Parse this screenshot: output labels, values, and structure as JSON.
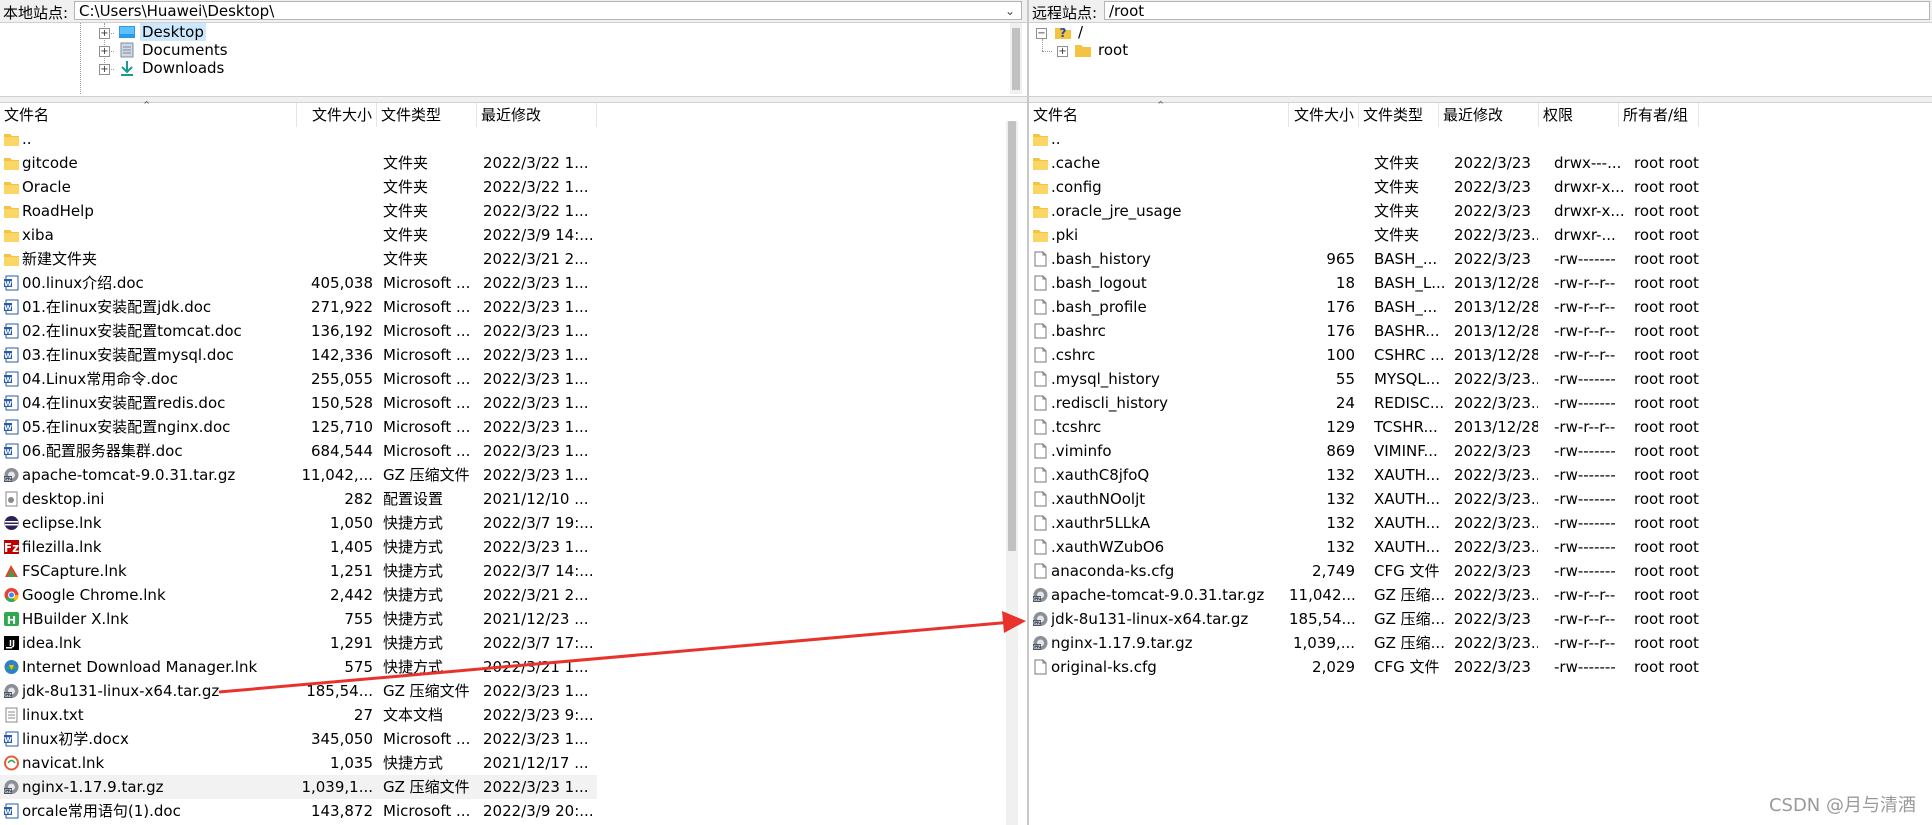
{
  "local": {
    "site_label": "本地站点:",
    "path": "C:\\Users\\Huawei\\Desktop\\",
    "tree": [
      {
        "label": "Desktop",
        "icon": "desktop-folder-icon"
      },
      {
        "label": "Documents",
        "icon": "documents-folder-icon"
      },
      {
        "label": "Downloads",
        "icon": "downloads-folder-icon"
      }
    ],
    "columns": {
      "name": "文件名",
      "size": "文件大小",
      "type": "文件类型",
      "modified": "最近修改"
    },
    "files": [
      {
        "name": "..",
        "size": "",
        "type": "",
        "modified": "",
        "icon": "folder"
      },
      {
        "name": "gitcode",
        "size": "",
        "type": "文件夹",
        "modified": "2022/3/22 1...",
        "icon": "folder"
      },
      {
        "name": "Oracle",
        "size": "",
        "type": "文件夹",
        "modified": "2022/3/22 1...",
        "icon": "folder"
      },
      {
        "name": "RoadHelp",
        "size": "",
        "type": "文件夹",
        "modified": "2022/3/22 1...",
        "icon": "folder"
      },
      {
        "name": "xiba",
        "size": "",
        "type": "文件夹",
        "modified": "2022/3/9 14:...",
        "icon": "folder"
      },
      {
        "name": "新建文件夹",
        "size": "",
        "type": "文件夹",
        "modified": "2022/3/21 2...",
        "icon": "folder"
      },
      {
        "name": "00.linux介绍.doc",
        "size": "405,038",
        "type": "Microsoft ...",
        "modified": "2022/3/23 1...",
        "icon": "word"
      },
      {
        "name": "01.在linux安装配置jdk.doc",
        "size": "271,922",
        "type": "Microsoft ...",
        "modified": "2022/3/23 1...",
        "icon": "word"
      },
      {
        "name": "02.在linux安装配置tomcat.doc",
        "size": "136,192",
        "type": "Microsoft ...",
        "modified": "2022/3/23 1...",
        "icon": "word"
      },
      {
        "name": "03.在linux安装配置mysql.doc",
        "size": "142,336",
        "type": "Microsoft ...",
        "modified": "2022/3/23 1...",
        "icon": "word"
      },
      {
        "name": "04.Linux常用命令.doc",
        "size": "255,055",
        "type": "Microsoft ...",
        "modified": "2022/3/23 1...",
        "icon": "word"
      },
      {
        "name": "04.在linux安装配置redis.doc",
        "size": "150,528",
        "type": "Microsoft ...",
        "modified": "2022/3/23 1...",
        "icon": "word"
      },
      {
        "name": "05.在linux安装配置nginx.doc",
        "size": "125,710",
        "type": "Microsoft ...",
        "modified": "2022/3/23 1...",
        "icon": "word"
      },
      {
        "name": "06.配置服务器集群.doc",
        "size": "684,544",
        "type": "Microsoft ...",
        "modified": "2022/3/23 1...",
        "icon": "word"
      },
      {
        "name": "apache-tomcat-9.0.31.tar.gz",
        "size": "11,042,...",
        "type": "GZ 压缩文件",
        "modified": "2022/3/23 1...",
        "icon": "archive"
      },
      {
        "name": "desktop.ini",
        "size": "282",
        "type": "配置设置",
        "modified": "2021/12/10 ...",
        "icon": "ini"
      },
      {
        "name": "eclipse.lnk",
        "size": "1,050",
        "type": "快捷方式",
        "modified": "2022/3/7 19:...",
        "icon": "eclipse"
      },
      {
        "name": "filezilla.lnk",
        "size": "1,405",
        "type": "快捷方式",
        "modified": "2022/3/23 1...",
        "icon": "filezilla"
      },
      {
        "name": "FSCapture.lnk",
        "size": "1,251",
        "type": "快捷方式",
        "modified": "2022/3/7 14:...",
        "icon": "fscapture"
      },
      {
        "name": "Google Chrome.lnk",
        "size": "2,442",
        "type": "快捷方式",
        "modified": "2022/3/21 2...",
        "icon": "chrome"
      },
      {
        "name": "HBuilder X.lnk",
        "size": "755",
        "type": "快捷方式",
        "modified": "2021/12/23 ...",
        "icon": "hbuilder"
      },
      {
        "name": "idea.lnk",
        "size": "1,291",
        "type": "快捷方式",
        "modified": "2022/3/7 17:...",
        "icon": "idea"
      },
      {
        "name": "Internet Download Manager.lnk",
        "size": "575",
        "type": "快捷方式",
        "modified": "2022/3/21 1...",
        "icon": "idm"
      },
      {
        "name": "jdk-8u131-linux-x64.tar.gz",
        "size": "185,54...",
        "type": "GZ 压缩文件",
        "modified": "2022/3/23 1...",
        "icon": "archive"
      },
      {
        "name": "linux.txt",
        "size": "27",
        "type": "文本文档",
        "modified": "2022/3/23 9:...",
        "icon": "txt"
      },
      {
        "name": "linux初学.docx",
        "size": "345,050",
        "type": "Microsoft ...",
        "modified": "2022/3/23 1...",
        "icon": "word"
      },
      {
        "name": "navicat.lnk",
        "size": "1,035",
        "type": "快捷方式",
        "modified": "2021/12/17 ...",
        "icon": "navicat"
      },
      {
        "name": "nginx-1.17.9.tar.gz",
        "size": "1,039,1...",
        "type": "GZ 压缩文件",
        "modified": "2022/3/23 1...",
        "icon": "archive",
        "selected": true
      },
      {
        "name": "orcale常用语句(1).doc",
        "size": "143,872",
        "type": "Microsoft ...",
        "modified": "2022/3/9 20:...",
        "icon": "word"
      }
    ]
  },
  "remote": {
    "site_label": "远程站点:",
    "path": "/root",
    "tree": [
      {
        "label": "/",
        "icon": "unknown-folder-icon"
      },
      {
        "label": "root",
        "icon": "folder-icon"
      }
    ],
    "columns": {
      "name": "文件名",
      "size": "文件大小",
      "type": "文件类型",
      "modified": "最近修改",
      "perms": "权限",
      "owner": "所有者/组"
    },
    "files": [
      {
        "name": "..",
        "size": "",
        "type": "",
        "modified": "",
        "perms": "",
        "owner": "",
        "icon": "folder"
      },
      {
        "name": ".cache",
        "size": "",
        "type": "文件夹",
        "modified": "2022/3/23",
        "perms": "drwx---...",
        "owner": "root root",
        "icon": "folder"
      },
      {
        "name": ".config",
        "size": "",
        "type": "文件夹",
        "modified": "2022/3/23",
        "perms": "drwxr-x...",
        "owner": "root root",
        "icon": "folder"
      },
      {
        "name": ".oracle_jre_usage",
        "size": "",
        "type": "文件夹",
        "modified": "2022/3/23",
        "perms": "drwxr-x...",
        "owner": "root root",
        "icon": "folder"
      },
      {
        "name": ".pki",
        "size": "",
        "type": "文件夹",
        "modified": "2022/3/23...",
        "perms": "drwxr-...",
        "owner": "root root",
        "icon": "folder"
      },
      {
        "name": ".bash_history",
        "size": "965",
        "type": "BASH_...",
        "modified": "2022/3/23",
        "perms": "-rw-------",
        "owner": "root root",
        "icon": "blank"
      },
      {
        "name": ".bash_logout",
        "size": "18",
        "type": "BASH_L...",
        "modified": "2013/12/28",
        "perms": "-rw-r--r--",
        "owner": "root root",
        "icon": "blank"
      },
      {
        "name": ".bash_profile",
        "size": "176",
        "type": "BASH_...",
        "modified": "2013/12/28",
        "perms": "-rw-r--r--",
        "owner": "root root",
        "icon": "blank"
      },
      {
        "name": ".bashrc",
        "size": "176",
        "type": "BASHR...",
        "modified": "2013/12/28",
        "perms": "-rw-r--r--",
        "owner": "root root",
        "icon": "blank"
      },
      {
        "name": ".cshrc",
        "size": "100",
        "type": "CSHRC ...",
        "modified": "2013/12/28",
        "perms": "-rw-r--r--",
        "owner": "root root",
        "icon": "blank"
      },
      {
        "name": ".mysql_history",
        "size": "55",
        "type": "MYSQL...",
        "modified": "2022/3/23...",
        "perms": "-rw-------",
        "owner": "root root",
        "icon": "blank"
      },
      {
        "name": ".rediscli_history",
        "size": "24",
        "type": "REDISC...",
        "modified": "2022/3/23...",
        "perms": "-rw-------",
        "owner": "root root",
        "icon": "blank"
      },
      {
        "name": ".tcshrc",
        "size": "129",
        "type": "TCSHR...",
        "modified": "2013/12/28",
        "perms": "-rw-r--r--",
        "owner": "root root",
        "icon": "blank"
      },
      {
        "name": ".viminfo",
        "size": "869",
        "type": "VIMINF...",
        "modified": "2022/3/23",
        "perms": "-rw-------",
        "owner": "root root",
        "icon": "blank"
      },
      {
        "name": ".xauthC8jfoQ",
        "size": "132",
        "type": "XAUTH...",
        "modified": "2022/3/23...",
        "perms": "-rw-------",
        "owner": "root root",
        "icon": "blank"
      },
      {
        "name": ".xauthNOoljt",
        "size": "132",
        "type": "XAUTH...",
        "modified": "2022/3/23...",
        "perms": "-rw-------",
        "owner": "root root",
        "icon": "blank"
      },
      {
        "name": ".xauthr5LLkA",
        "size": "132",
        "type": "XAUTH...",
        "modified": "2022/3/23...",
        "perms": "-rw-------",
        "owner": "root root",
        "icon": "blank"
      },
      {
        "name": ".xauthWZubO6",
        "size": "132",
        "type": "XAUTH...",
        "modified": "2022/3/23...",
        "perms": "-rw-------",
        "owner": "root root",
        "icon": "blank"
      },
      {
        "name": "anaconda-ks.cfg",
        "size": "2,749",
        "type": "CFG 文件",
        "modified": "2022/3/23",
        "perms": "-rw-------",
        "owner": "root root",
        "icon": "blank"
      },
      {
        "name": "apache-tomcat-9.0.31.tar.gz",
        "size": "11,042...",
        "type": "GZ 压缩...",
        "modified": "2022/3/23...",
        "perms": "-rw-r--r--",
        "owner": "root root",
        "icon": "archive"
      },
      {
        "name": "jdk-8u131-linux-x64.tar.gz",
        "size": "185,54...",
        "type": "GZ 压缩...",
        "modified": "2022/3/23",
        "perms": "-rw-r--r--",
        "owner": "root root",
        "icon": "archive"
      },
      {
        "name": "nginx-1.17.9.tar.gz",
        "size": "1,039,...",
        "type": "GZ 压缩...",
        "modified": "2022/3/23...",
        "perms": "-rw-r--r--",
        "owner": "root root",
        "icon": "archive"
      },
      {
        "name": "original-ks.cfg",
        "size": "2,029",
        "type": "CFG 文件",
        "modified": "2022/3/23",
        "perms": "-rw-------",
        "owner": "root root",
        "icon": "blank"
      }
    ]
  },
  "watermark": "CSDN @月与清酒",
  "colors": {
    "arrow": "#e8332d",
    "folder": "#f5c342",
    "selection": "#cce8ff"
  }
}
